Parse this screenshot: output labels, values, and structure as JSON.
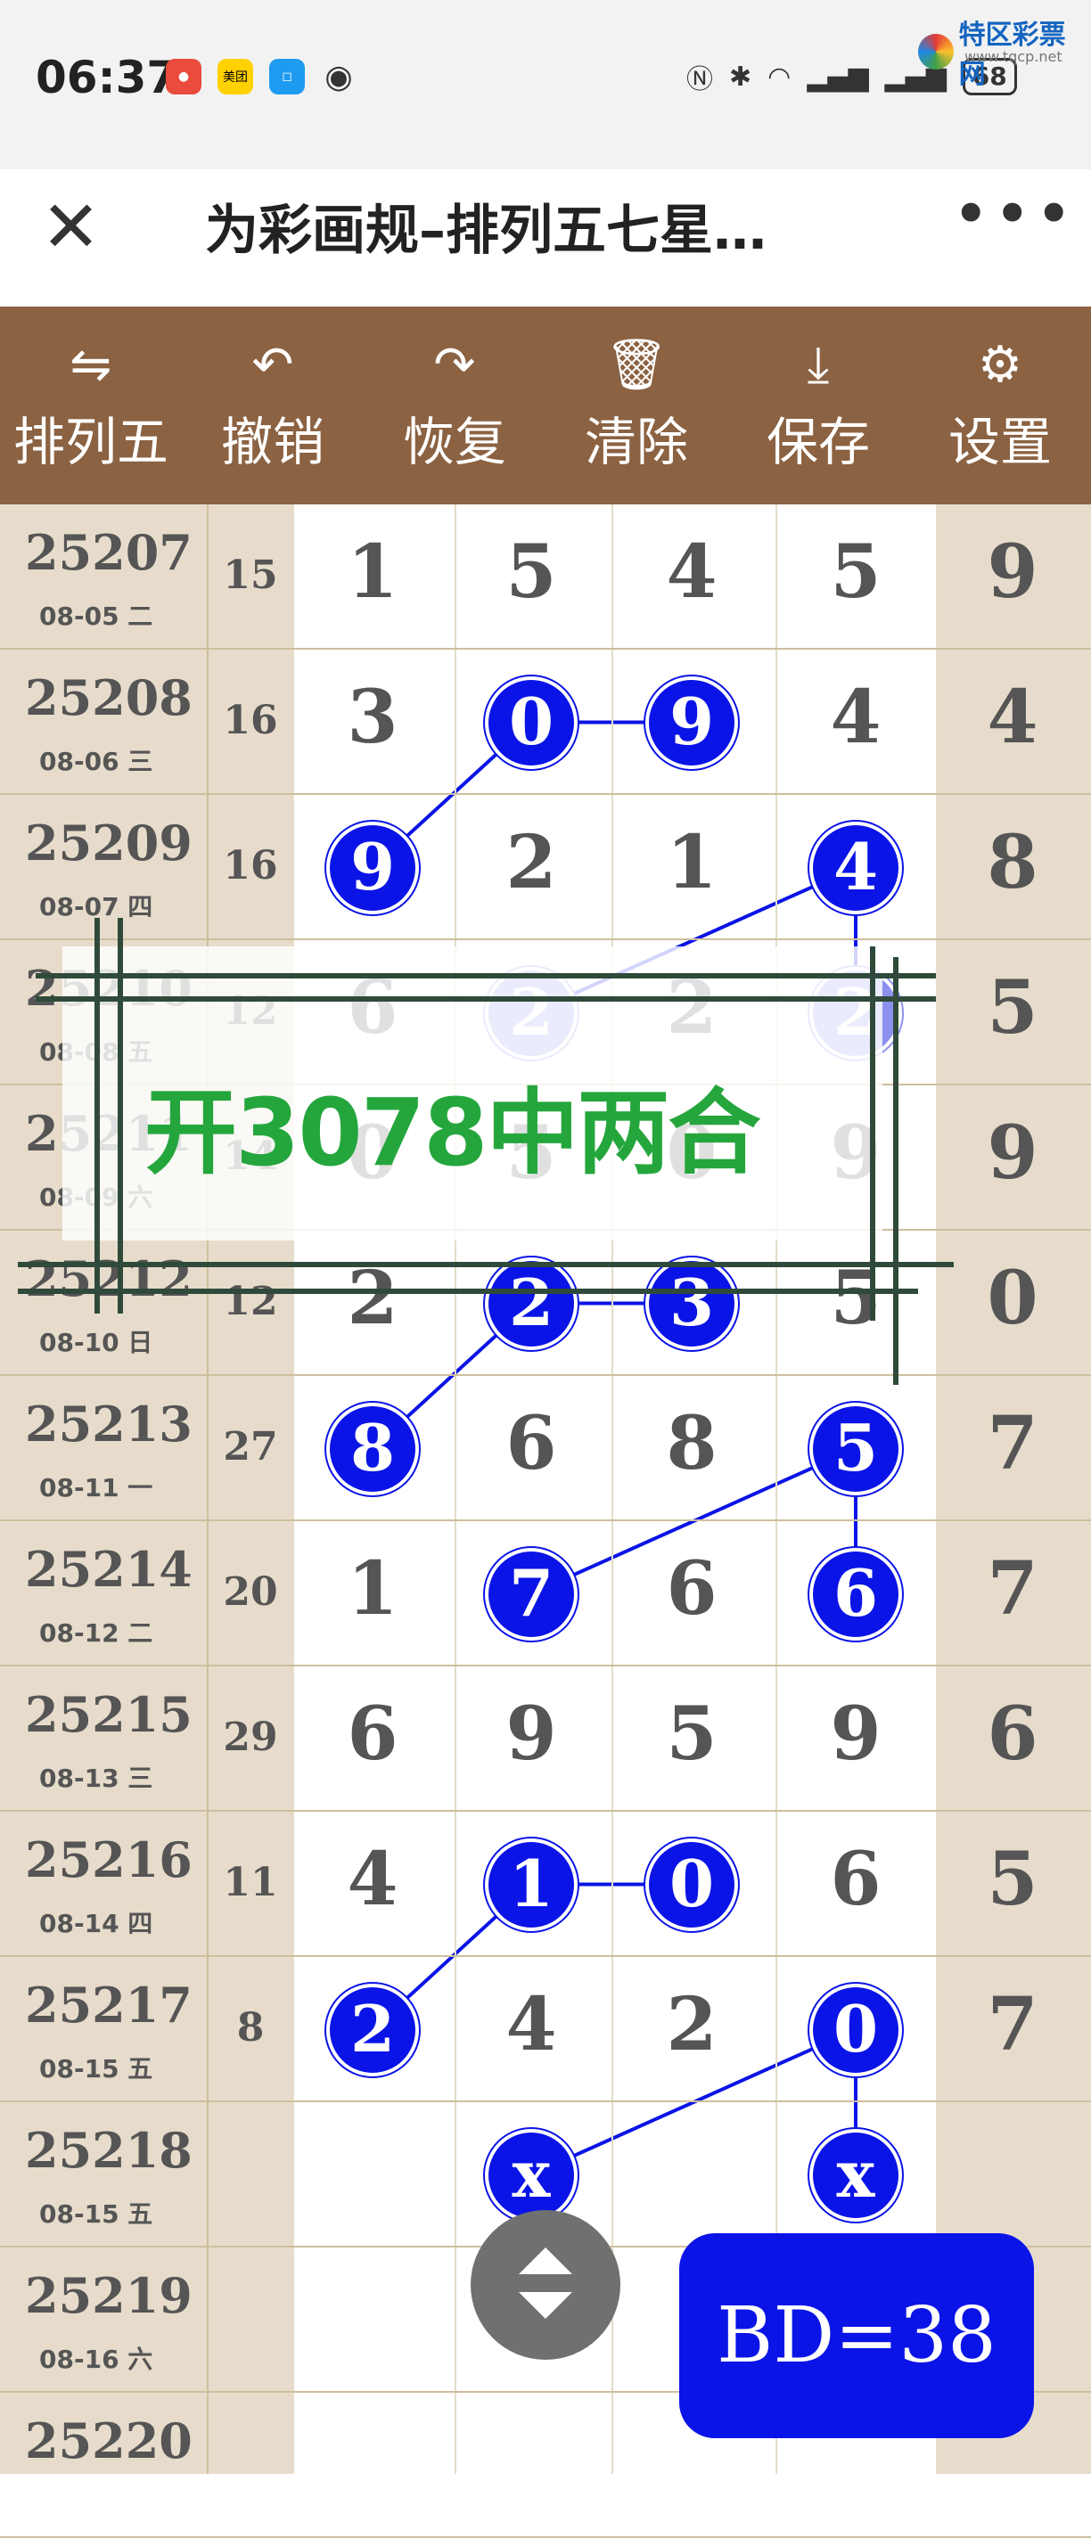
{
  "status_bar": {
    "time": "06:37",
    "battery": "68",
    "app_badge": "美团",
    "logo_text": "特区彩票网",
    "logo_sub": "www.tqcp.net"
  },
  "nav": {
    "title": "为彩画规–排列五七星…",
    "close_icon": "close-icon",
    "more_icon": "more-icon"
  },
  "toolbar": {
    "items": [
      {
        "label": "排列五",
        "icon": "⇋"
      },
      {
        "label": "撤销",
        "icon": "↶"
      },
      {
        "label": "恢复",
        "icon": "↷"
      },
      {
        "label": "清除",
        "icon": "🗑"
      },
      {
        "label": "保存",
        "icon": "⤓"
      },
      {
        "label": "设置",
        "icon": "⚙"
      }
    ]
  },
  "rows": [
    {
      "period": "25207",
      "date": "08-05 二",
      "sum": "15",
      "digits": [
        "1",
        "5",
        "4",
        "5"
      ],
      "last": "9"
    },
    {
      "period": "25208",
      "date": "08-06 三",
      "sum": "16",
      "digits": [
        "3",
        "0",
        "9",
        "4"
      ],
      "last": "4"
    },
    {
      "period": "25209",
      "date": "08-07 四",
      "sum": "16",
      "digits": [
        "9",
        "2",
        "1",
        "4"
      ],
      "last": "8"
    },
    {
      "period": "25210",
      "date": "08-08 五",
      "sum": "12",
      "digits": [
        "6",
        "2",
        "2",
        "2"
      ],
      "last": "5"
    },
    {
      "period": "25211",
      "date": "08-09 六",
      "sum": "14",
      "digits": [
        "0",
        "5",
        "0",
        "9"
      ],
      "last": "9"
    },
    {
      "period": "25212",
      "date": "08-10 日",
      "sum": "12",
      "digits": [
        "2",
        "2",
        "3",
        "5"
      ],
      "last": "0"
    },
    {
      "period": "25213",
      "date": "08-11 一",
      "sum": "27",
      "digits": [
        "8",
        "6",
        "8",
        "5"
      ],
      "last": "7"
    },
    {
      "period": "25214",
      "date": "08-12 二",
      "sum": "20",
      "digits": [
        "1",
        "7",
        "6",
        "6"
      ],
      "last": "7"
    },
    {
      "period": "25215",
      "date": "08-13 三",
      "sum": "29",
      "digits": [
        "6",
        "9",
        "5",
        "9"
      ],
      "last": "6"
    },
    {
      "period": "25216",
      "date": "08-14 四",
      "sum": "11",
      "digits": [
        "4",
        "1",
        "0",
        "6"
      ],
      "last": "5"
    },
    {
      "period": "25217",
      "date": "08-15 五",
      "sum": "8",
      "digits": [
        "2",
        "4",
        "2",
        "0"
      ],
      "last": "7"
    },
    {
      "period": "25218",
      "date": "08-15 五",
      "sum": "",
      "digits": [
        "",
        "x",
        "",
        "x"
      ],
      "last": ""
    },
    {
      "period": "25219",
      "date": "08-16 六",
      "sum": "",
      "digits": [
        "",
        "",
        "",
        ""
      ],
      "last": ""
    },
    {
      "period": "25220",
      "date": "",
      "sum": "",
      "digits": [
        "",
        "",
        "",
        ""
      ],
      "last": ""
    }
  ],
  "highlights": [
    {
      "row": 1,
      "col": 1
    },
    {
      "row": 1,
      "col": 2
    },
    {
      "row": 2,
      "col": 0
    },
    {
      "row": 2,
      "col": 3
    },
    {
      "row": 3,
      "col": 1,
      "faded": true
    },
    {
      "row": 3,
      "col": 3,
      "faded": true
    },
    {
      "row": 5,
      "col": 1
    },
    {
      "row": 5,
      "col": 2
    },
    {
      "row": 6,
      "col": 0
    },
    {
      "row": 6,
      "col": 3
    },
    {
      "row": 7,
      "col": 1
    },
    {
      "row": 7,
      "col": 3
    },
    {
      "row": 9,
      "col": 1
    },
    {
      "row": 9,
      "col": 2
    },
    {
      "row": 10,
      "col": 0
    },
    {
      "row": 10,
      "col": 3
    },
    {
      "row": 11,
      "col": 1
    },
    {
      "row": 11,
      "col": 3
    }
  ],
  "links": [
    [
      [
        1,
        1
      ],
      [
        1,
        2
      ]
    ],
    [
      [
        1,
        1
      ],
      [
        2,
        0
      ]
    ],
    [
      [
        2,
        3
      ],
      [
        3,
        1
      ]
    ],
    [
      [
        2,
        3
      ],
      [
        3,
        3
      ]
    ],
    [
      [
        5,
        1
      ],
      [
        5,
        2
      ]
    ],
    [
      [
        5,
        1
      ],
      [
        6,
        0
      ]
    ],
    [
      [
        6,
        3
      ],
      [
        7,
        1
      ]
    ],
    [
      [
        6,
        3
      ],
      [
        7,
        3
      ]
    ],
    [
      [
        9,
        1
      ],
      [
        9,
        2
      ]
    ],
    [
      [
        9,
        1
      ],
      [
        10,
        0
      ]
    ],
    [
      [
        10,
        3
      ],
      [
        11,
        1
      ]
    ],
    [
      [
        10,
        3
      ],
      [
        11,
        3
      ]
    ]
  ],
  "overlay": {
    "text": "开3078中两合"
  },
  "bd_badge": "BD=38",
  "colors": {
    "toolbar": "#8b6242",
    "circle": "#0a14e6",
    "overlay_text": "#25a63d",
    "side_col": "#e7dccb"
  }
}
